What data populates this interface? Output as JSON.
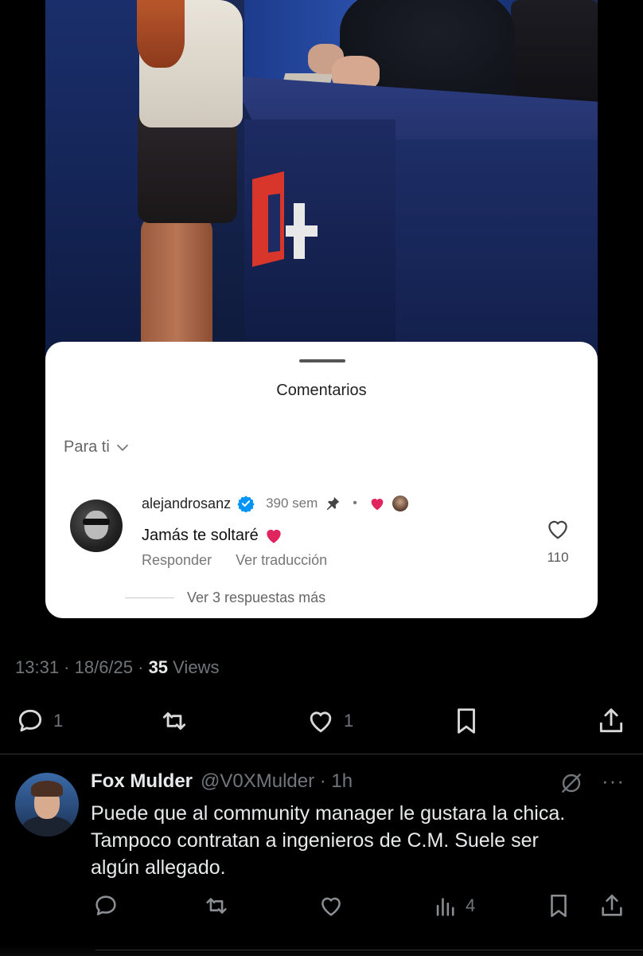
{
  "comments_sheet": {
    "title": "Comentarios",
    "sort_label": "Para ti",
    "comment": {
      "username": "alejandrosanz",
      "time": "390 sem",
      "text": "Jamás te soltaré",
      "reply_label": "Responder",
      "translate_label": "Ver traducción",
      "like_count": "110"
    },
    "more_replies_label": "Ver 3 respuestas más"
  },
  "tweet": {
    "time_date": "13:31 · 18/6/25 · ",
    "views_count": "35",
    "views_label": " Views",
    "actions": {
      "replies": "1",
      "reposts": "",
      "likes": "1"
    }
  },
  "reply": {
    "name": "Fox Mulder",
    "handle_time": "@V0XMulder · 1h",
    "text": "Puede que al community manager le gustara la chica.\nTampoco contratan a ingenieros de C.M. Suele ser\nalgún allegado.",
    "views": "4",
    "more": "···"
  },
  "colors": {
    "background": "#000000",
    "secondary_text": "#71767b",
    "primary_text": "#e7e9ea",
    "ig_verified": "#0095f6",
    "heart_red": "#e0245e"
  }
}
